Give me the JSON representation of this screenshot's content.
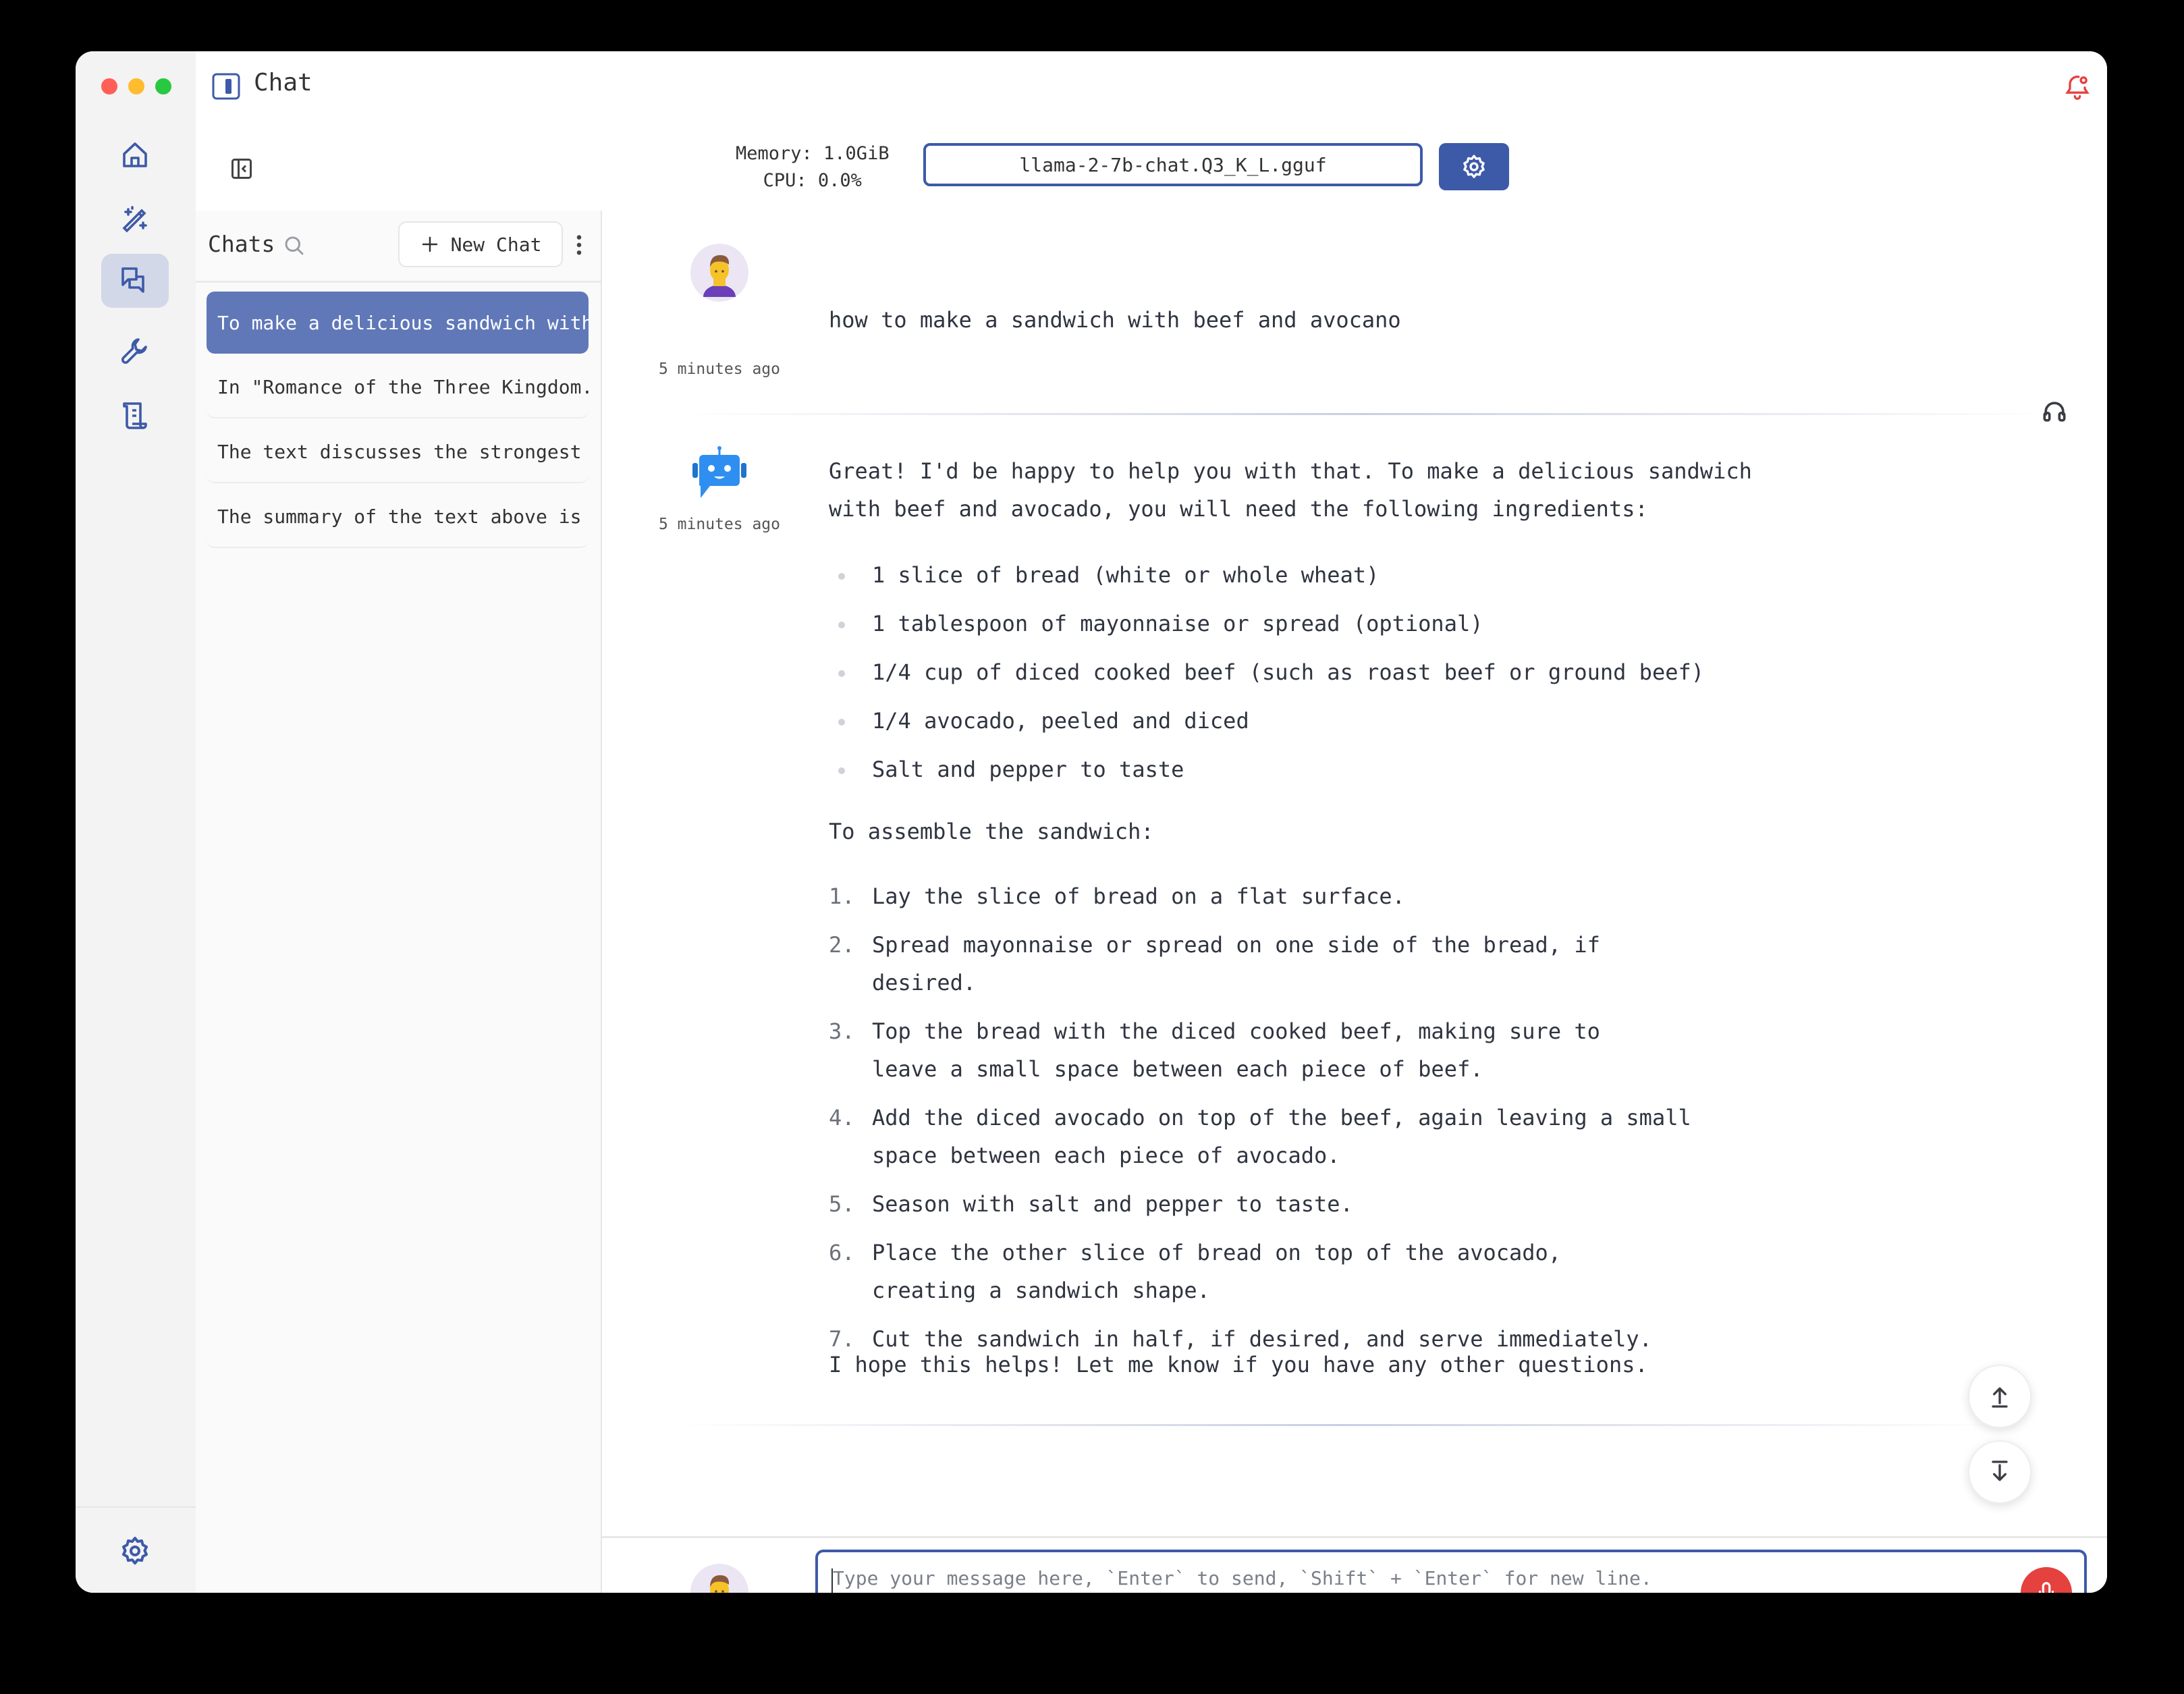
{
  "window": {
    "title": "Chat",
    "traffic_lights": {
      "close": "#ff5f57",
      "minimize": "#febc2e",
      "maximize": "#28c840"
    }
  },
  "colors": {
    "accent": "#3d5aa8",
    "active_chat_bg": "#6078b8",
    "rail_active_bg": "#d2d8e8",
    "notification": "#e5413f",
    "mic": "#e5413f",
    "bot_icon": "#2f8ff0"
  },
  "rail": {
    "items": [
      {
        "name": "home",
        "icon": "home-icon",
        "active": false
      },
      {
        "name": "magic",
        "icon": "magic-wand-icon",
        "active": false
      },
      {
        "name": "chat",
        "icon": "chat-bubbles-icon",
        "active": true
      },
      {
        "name": "tools",
        "icon": "wrench-icon",
        "active": false
      },
      {
        "name": "scroll",
        "icon": "scroll-icon",
        "active": false
      }
    ],
    "settings_icon": "gear-icon"
  },
  "toolbar": {
    "memory_label": "Memory: 1.0GiB",
    "cpu_label": "CPU: 0.0%",
    "model": "llama-2-7b-chat.Q3_K_L.gguf"
  },
  "chatlist": {
    "title": "Chats",
    "new_chat_label": "New Chat",
    "items": [
      {
        "label": "To make a delicious sandwich with...",
        "active": true
      },
      {
        "label": "In \"Romance of the Three Kingdom...",
        "active": false
      },
      {
        "label": "The text discusses the strongest ...",
        "active": false
      },
      {
        "label": "The summary of the text above is ...",
        "active": false
      }
    ]
  },
  "messages": [
    {
      "role": "user",
      "timestamp": "5 minutes ago",
      "text": "how to make a sandwich with beef and avocano"
    },
    {
      "role": "assistant",
      "timestamp": "5 minutes ago",
      "intro_line1": "Great! I'd be happy to help you with that. To make a delicious sandwich",
      "intro_line2": "with beef and avocado, you will need the following ingredients:",
      "ingredients": [
        "1 slice of bread (white or whole wheat)",
        "1 tablespoon of mayonnaise or spread (optional)",
        "1/4 cup of diced cooked beef (such as roast beef or ground beef)",
        "1/4 avocado, peeled and diced",
        "Salt and pepper to taste"
      ],
      "assemble_heading": "To assemble the sandwich:",
      "steps": [
        {
          "num": "1.",
          "text": "Lay the slice of bread on a flat surface."
        },
        {
          "num": "2.",
          "text": "Spread mayonnaise or spread on one side of the bread, if desired."
        },
        {
          "num": "3.",
          "text": "Top the bread with the diced cooked beef, making sure to leave a small space between each piece of beef."
        },
        {
          "num": "4.",
          "text": "Add the diced avocado on top of the beef, again leaving a small space between each piece of avocado."
        },
        {
          "num": "5.",
          "text": "Season with salt and pepper to taste."
        },
        {
          "num": "6.",
          "text": "Place the other slice of bread on top of the avocado, creating a sandwich shape."
        },
        {
          "num": "7.",
          "text": "Cut the sandwich in half, if desired, and serve immediately."
        }
      ],
      "closing": "I hope this helps! Let me know if you have any other questions."
    }
  ],
  "composer": {
    "placeholder": "Type your message here, `Enter` to send, `Shift` + `Enter` for new line.",
    "value": ""
  }
}
